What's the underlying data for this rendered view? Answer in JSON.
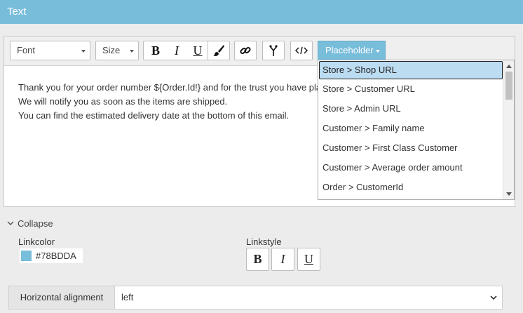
{
  "panel": {
    "title": "Text"
  },
  "toolbar": {
    "font_label": "Font",
    "size_label": "Size",
    "bold_label": "B",
    "italic_label": "I",
    "underline_label": "U",
    "color_icon": "paint-brush-icon",
    "link_icon": "link-icon",
    "condition_icon": "fork-icon",
    "source_icon": "code-icon",
    "placeholder_label": "Placeholder"
  },
  "editor": {
    "lines": [
      "Thank you for your order number ${Order.Id!} and for the trust you have placed in us.",
      "We will notify you as soon as the items are shipped.",
      "You can find the estimated delivery date at the bottom of this email."
    ]
  },
  "placeholder_menu": {
    "items": [
      "Store > Shop URL",
      "Store > Customer URL",
      "Store > Admin URL",
      "Customer > Family name",
      "Customer > First Class Customer",
      "Customer > Average order amount",
      "Order > CustomerId"
    ],
    "selected_index": 0
  },
  "collapse": {
    "label": "Collapse"
  },
  "linkcolor": {
    "label": "Linkcolor",
    "value": "#78BDDA",
    "swatch": "#78BDDA"
  },
  "linkstyle": {
    "label": "Linkstyle",
    "bold": "B",
    "italic": "I",
    "underline": "U"
  },
  "alignment": {
    "label": "Horizontal alignment",
    "value": "left"
  },
  "colors": {
    "accent": "#78BDDA",
    "selected_bg": "#BCDCF1"
  }
}
